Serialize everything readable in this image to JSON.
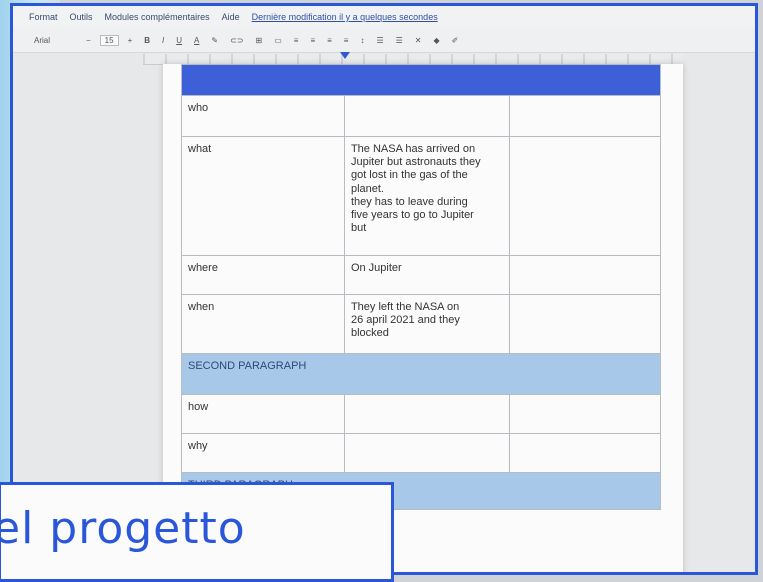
{
  "menubar": {
    "items": [
      "Format",
      "Outils",
      "Modules complémentaires",
      "Aide"
    ],
    "last_edit": "Dernière modification il y a quelques secondes"
  },
  "toolbar": {
    "font": "Arial",
    "size": "15",
    "buttons": [
      "B",
      "I",
      "U",
      "A"
    ]
  },
  "table": {
    "rows": [
      {
        "type": "row",
        "cells": [
          "who",
          "",
          ""
        ]
      },
      {
        "type": "row",
        "cells": [
          "what",
          "The NASA has arrived on\nJupiter but astronauts they\ngot lost in the gas of the\nplanet.\nthey has to leave during\nfive years to go to Jupiter\nbut",
          ""
        ]
      },
      {
        "type": "row",
        "cells": [
          "where",
          "On Jupiter",
          ""
        ]
      },
      {
        "type": "row",
        "cells": [
          "when",
          "They left the NASA on\n26 april 2021 and they\nblocked",
          ""
        ]
      },
      {
        "type": "section",
        "label": "SECOND PARAGRAPH"
      },
      {
        "type": "row",
        "cells": [
          "how",
          "",
          ""
        ]
      },
      {
        "type": "row",
        "cells": [
          "why",
          "",
          ""
        ]
      },
      {
        "type": "section",
        "label": "THIRD PARAGRAPH"
      }
    ]
  },
  "caption": {
    "text": "el progetto"
  },
  "colors": {
    "accent": "#2a57d9",
    "section_fill": "#a8c8ea",
    "header_fill": "#3d5fd8"
  }
}
